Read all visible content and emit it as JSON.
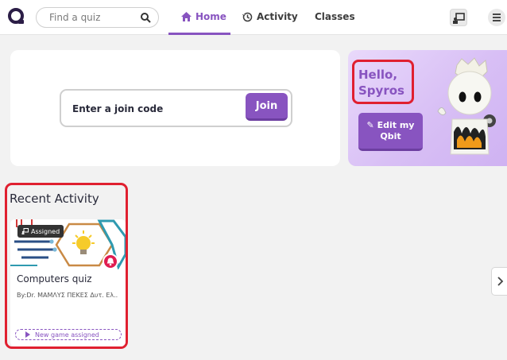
{
  "nav": {
    "search_placeholder": "Find a quiz",
    "tabs": [
      {
        "label": "Home",
        "icon": "home-icon",
        "active": true
      },
      {
        "label": "Activity",
        "icon": "history-icon",
        "active": false
      },
      {
        "label": "Classes",
        "icon": "",
        "active": false
      }
    ]
  },
  "join": {
    "placeholder": "Enter a join code",
    "button_label": "Join"
  },
  "profile": {
    "greeting": "Hello,",
    "name": "Spyros",
    "edit_line1": "Edit my",
    "edit_line2": "Qbit"
  },
  "recent": {
    "title": "Recent Activity",
    "cards": [
      {
        "badge": "Assigned",
        "title": "Computers quiz",
        "author": "By:Dr. ΜΑΜΛΥΣ ΠΕΚΕΣ Δυτ. Ελ..",
        "status": "New game assigned"
      }
    ]
  },
  "colors": {
    "accent": "#8854c0",
    "highlight": "#e02030",
    "notification": "#e01d50",
    "hello_bg": "#dcc6f7"
  }
}
